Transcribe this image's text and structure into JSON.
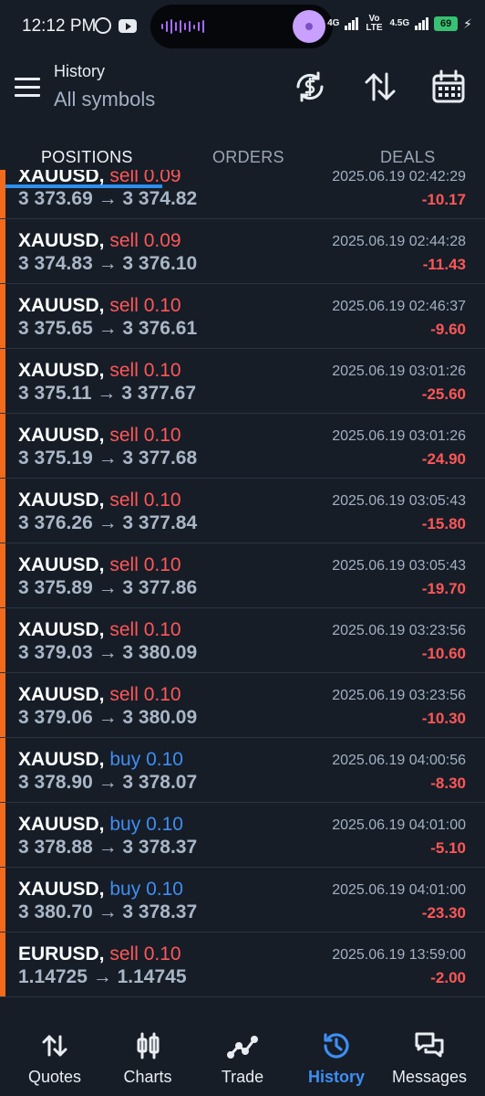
{
  "status_bar": {
    "time": "12:12 PM",
    "network_left": "4G",
    "network_mid": "Vo LTE",
    "network_right": "4.5G",
    "battery": "69"
  },
  "header": {
    "title": "History",
    "subtitle": "All symbols",
    "icons": [
      "menu-icon",
      "currency-exchange-icon",
      "sort-icon",
      "calendar-icon"
    ]
  },
  "tabs": [
    {
      "label": "POSITIONS",
      "active": true
    },
    {
      "label": "ORDERS",
      "active": false
    },
    {
      "label": "DEALS",
      "active": false
    }
  ],
  "rows": [
    {
      "symbol": "XAUUSD,",
      "type": "sell",
      "volume": "0.09",
      "open": "3 373.69",
      "close": "3 374.82",
      "time": "2025.06.19 02:42:29",
      "profit": "-10.17"
    },
    {
      "symbol": "XAUUSD,",
      "type": "sell",
      "volume": "0.09",
      "open": "3 374.83",
      "close": "3 376.10",
      "time": "2025.06.19 02:44:28",
      "profit": "-11.43"
    },
    {
      "symbol": "XAUUSD,",
      "type": "sell",
      "volume": "0.10",
      "open": "3 375.65",
      "close": "3 376.61",
      "time": "2025.06.19 02:46:37",
      "profit": "-9.60"
    },
    {
      "symbol": "XAUUSD,",
      "type": "sell",
      "volume": "0.10",
      "open": "3 375.11",
      "close": "3 377.67",
      "time": "2025.06.19 03:01:26",
      "profit": "-25.60"
    },
    {
      "symbol": "XAUUSD,",
      "type": "sell",
      "volume": "0.10",
      "open": "3 375.19",
      "close": "3 377.68",
      "time": "2025.06.19 03:01:26",
      "profit": "-24.90"
    },
    {
      "symbol": "XAUUSD,",
      "type": "sell",
      "volume": "0.10",
      "open": "3 376.26",
      "close": "3 377.84",
      "time": "2025.06.19 03:05:43",
      "profit": "-15.80"
    },
    {
      "symbol": "XAUUSD,",
      "type": "sell",
      "volume": "0.10",
      "open": "3 375.89",
      "close": "3 377.86",
      "time": "2025.06.19 03:05:43",
      "profit": "-19.70"
    },
    {
      "symbol": "XAUUSD,",
      "type": "sell",
      "volume": "0.10",
      "open": "3 379.03",
      "close": "3 380.09",
      "time": "2025.06.19 03:23:56",
      "profit": "-10.60"
    },
    {
      "symbol": "XAUUSD,",
      "type": "sell",
      "volume": "0.10",
      "open": "3 379.06",
      "close": "3 380.09",
      "time": "2025.06.19 03:23:56",
      "profit": "-10.30"
    },
    {
      "symbol": "XAUUSD,",
      "type": "buy",
      "volume": "0.10",
      "open": "3 378.90",
      "close": "3 378.07",
      "time": "2025.06.19 04:00:56",
      "profit": "-8.30"
    },
    {
      "symbol": "XAUUSD,",
      "type": "buy",
      "volume": "0.10",
      "open": "3 378.88",
      "close": "3 378.37",
      "time": "2025.06.19 04:01:00",
      "profit": "-5.10"
    },
    {
      "symbol": "XAUUSD,",
      "type": "buy",
      "volume": "0.10",
      "open": "3 380.70",
      "close": "3 378.37",
      "time": "2025.06.19 04:01:00",
      "profit": "-23.30"
    },
    {
      "symbol": "EURUSD,",
      "type": "sell",
      "volume": "0.10",
      "open": "1.14725",
      "close": "1.14745",
      "time": "2025.06.19 13:59:00",
      "profit": "-2.00"
    }
  ],
  "nav": [
    {
      "label": "Quotes",
      "icon": "quotes-icon",
      "active": false
    },
    {
      "label": "Charts",
      "icon": "charts-icon",
      "active": false
    },
    {
      "label": "Trade",
      "icon": "trade-icon",
      "active": false
    },
    {
      "label": "History",
      "icon": "history-icon",
      "active": true
    },
    {
      "label": "Messages",
      "icon": "messages-icon",
      "active": false
    }
  ],
  "colors": {
    "background": "#161d27",
    "sell": "#ff5757",
    "buy": "#3e8ef2",
    "loss": "#ff5757",
    "row_marker": "#f26b1d",
    "accent": "#2e8ff0"
  }
}
